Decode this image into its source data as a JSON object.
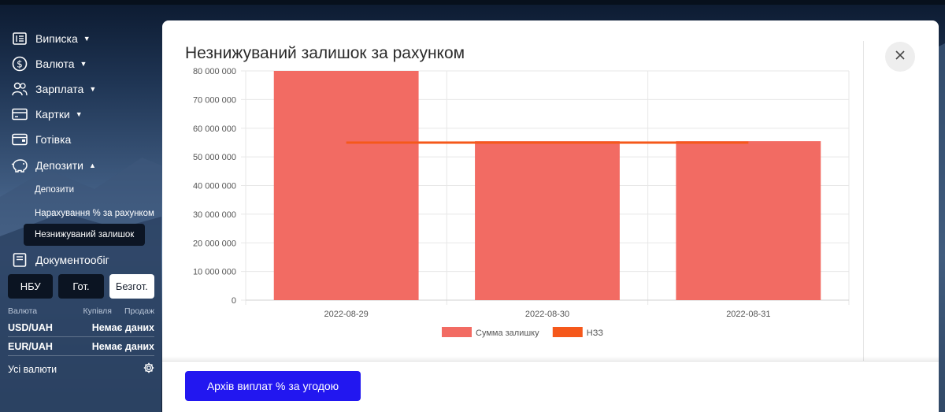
{
  "sidebar": {
    "items": [
      {
        "label": "Виписка",
        "icon": "statement-icon",
        "caret": "▼"
      },
      {
        "label": "Валюта",
        "icon": "dollar-circle-icon",
        "caret": "▼"
      },
      {
        "label": "Зарплата",
        "icon": "users-icon",
        "caret": "▼"
      },
      {
        "label": "Картки",
        "icon": "card-icon",
        "caret": "▼"
      },
      {
        "label": "Готівка",
        "icon": "wallet-icon",
        "caret": ""
      },
      {
        "label": "Депозити",
        "icon": "piggy-bank-icon",
        "caret": "▲"
      },
      {
        "label": "Документообіг",
        "icon": "document-icon",
        "caret": ""
      }
    ],
    "deposit_sub": [
      "Депозити",
      "Нарахування % за рахунком",
      "Незнижуваний залишок"
    ]
  },
  "rates": {
    "tabs": [
      "НБУ",
      "Гот.",
      "Безгот."
    ],
    "active_tab": "Безгот.",
    "headers": [
      "Валюта",
      "Купівля",
      "Продаж"
    ],
    "rows": [
      {
        "pair": "USD/UAH",
        "value": "Немає даних"
      },
      {
        "pair": "EUR/UAH",
        "value": "Немає даних"
      }
    ],
    "all_label": "Усі валюти"
  },
  "modal": {
    "title": "Незнижуваний залишок за рахунком",
    "close_icon": "close-icon",
    "archive_button": "Архів виплат % за угодою"
  },
  "chart_data": {
    "type": "bar",
    "categories": [
      "2022-08-29",
      "2022-08-30",
      "2022-08-31"
    ],
    "series": [
      {
        "name": "Сумма залишку",
        "type": "bar",
        "color": "#f26b63",
        "values": [
          81000000,
          55500000,
          55500000
        ]
      },
      {
        "name": "НЗЗ",
        "type": "line",
        "color": "#f5581b",
        "values": [
          55000000,
          55000000,
          55000000
        ]
      }
    ],
    "y_ticks": [
      "0",
      "10 000 000",
      "20 000 000",
      "30 000 000",
      "40 000 000",
      "50 000 000",
      "60 000 000",
      "70 000 000",
      "80 000 000"
    ],
    "ylim": [
      0,
      80000000
    ],
    "grid": true,
    "legend": "bottom"
  },
  "colors": {
    "accent": "#2217f0",
    "bar": "#f26b63",
    "line": "#f5581b"
  }
}
